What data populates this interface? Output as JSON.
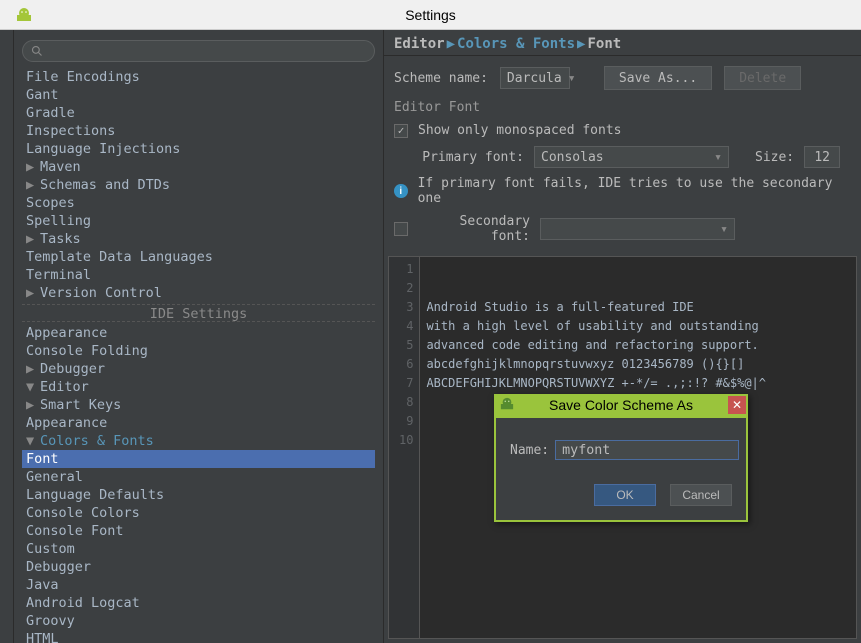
{
  "titlebar": {
    "title": "Settings"
  },
  "breadcrumb": {
    "a": "Editor",
    "b": "Colors & Fonts",
    "c": "Font"
  },
  "scheme": {
    "label": "Scheme name:",
    "value": "Darcula",
    "save_as": "Save As...",
    "delete": "Delete"
  },
  "editorfont": {
    "title": "Editor Font",
    "show_mono": "Show only monospaced fonts",
    "primary_label": "Primary font:",
    "primary_value": "Consolas",
    "size_label": "Size:",
    "size_value": "12",
    "info": "If primary font fails, IDE tries to use the secondary one",
    "secondary_label": "Secondary font:",
    "secondary_value": ""
  },
  "code": {
    "l1": "Android Studio is a full-featured IDE",
    "l2": "with a high level of usability and outstanding",
    "l3": "advanced code editing and refactoring support.",
    "l4": "",
    "l5": "abcdefghijklmnopqrstuvwxyz 0123456789 (){}[]",
    "l6": "ABCDEFGHIJKLMNOPQRSTUVWXYZ +-*/= .,;:!? #&$%@|^",
    "l7": "",
    "l8": "",
    "l9": "",
    "l10": ""
  },
  "linenums": {
    "n1": "1",
    "n2": "2",
    "n3": "3",
    "n4": "4",
    "n5": "5",
    "n6": "6",
    "n7": "7",
    "n8": "8",
    "n9": "9",
    "n10": "10"
  },
  "dialog": {
    "title": "Save Color Scheme As",
    "name_label": "Name:",
    "name_value": "myfont",
    "ok": "OK",
    "cancel": "Cancel"
  },
  "tree": {
    "file_encodings": "File Encodings",
    "gant": "Gant",
    "gradle": "Gradle",
    "inspections": "Inspections",
    "lang_inj": "Language Injections",
    "maven": "Maven",
    "schemas": "Schemas and DTDs",
    "scopes": "Scopes",
    "spelling": "Spelling",
    "tasks": "Tasks",
    "tdl": "Template Data Languages",
    "terminal": "Terminal",
    "vc": "Version Control",
    "heading": "IDE Settings",
    "appearance": "Appearance",
    "console_folding": "Console Folding",
    "debugger": "Debugger",
    "editor": "Editor",
    "smart_keys": "Smart Keys",
    "appearance2": "Appearance",
    "colors_fonts": "Colors & Fonts",
    "font": "Font",
    "general": "General",
    "lang_defaults": "Language Defaults",
    "console_colors": "Console Colors",
    "console_font": "Console Font",
    "custom": "Custom",
    "debugger2": "Debugger",
    "java": "Java",
    "android_logcat": "Android Logcat",
    "groovy": "Groovy",
    "html": "HTML"
  }
}
